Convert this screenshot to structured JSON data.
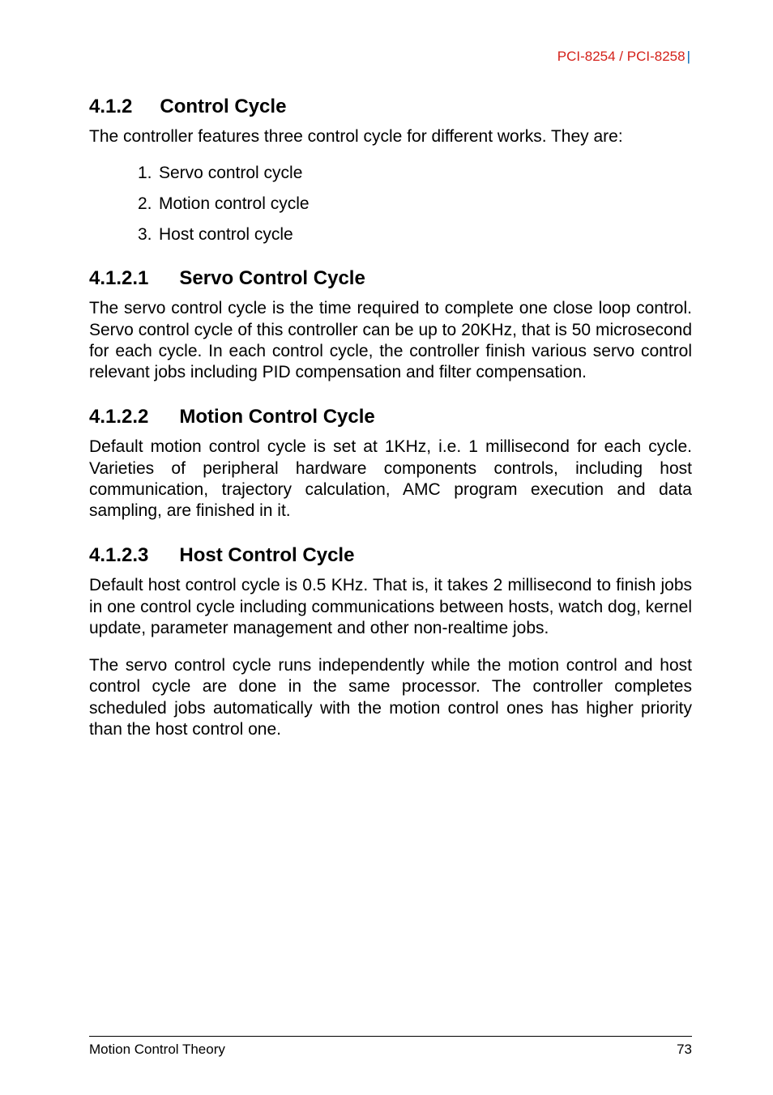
{
  "running_header": {
    "title": "PCI-8254 / PCI-8258",
    "bar": "|"
  },
  "s412": {
    "num": "4.1.2",
    "title": "Control Cycle",
    "intro": "The controller features three control cycle for different works. They are:",
    "items": [
      {
        "n": "1.",
        "t": "Servo control cycle"
      },
      {
        "n": "2.",
        "t": "Motion control cycle"
      },
      {
        "n": "3.",
        "t": "Host control cycle"
      }
    ]
  },
  "s4121": {
    "num": "4.1.2.1",
    "title": "Servo Control Cycle",
    "p": "The servo control cycle is the time required to complete one close loop control. Servo control cycle of this controller can be up to 20KHz, that is 50 microsecond for each cycle. In each control cycle, the controller finish various servo control relevant jobs including PID compensation and filter compensation."
  },
  "s4122": {
    "num": "4.1.2.2",
    "title": "Motion Control Cycle",
    "p": "Default motion control cycle is set at 1KHz, i.e. 1 millisecond for each cycle. Varieties of peripheral hardware components controls, including host communication, trajectory calculation, AMC program execution and data sampling, are finished in it."
  },
  "s4123": {
    "num": "4.1.2.3",
    "title": "Host Control Cycle",
    "p1": "Default host control cycle is 0.5 KHz. That is, it takes 2 millisecond to finish jobs in one control cycle including communications between hosts, watch dog, kernel update, parameter management and other non-realtime jobs.",
    "p2": "The servo control cycle runs independently while the motion control and host control cycle are done in the same processor. The controller completes scheduled jobs automatically with the motion control ones has higher priority than the host control one."
  },
  "footer": {
    "left": "Motion Control Theory",
    "right": "73"
  }
}
